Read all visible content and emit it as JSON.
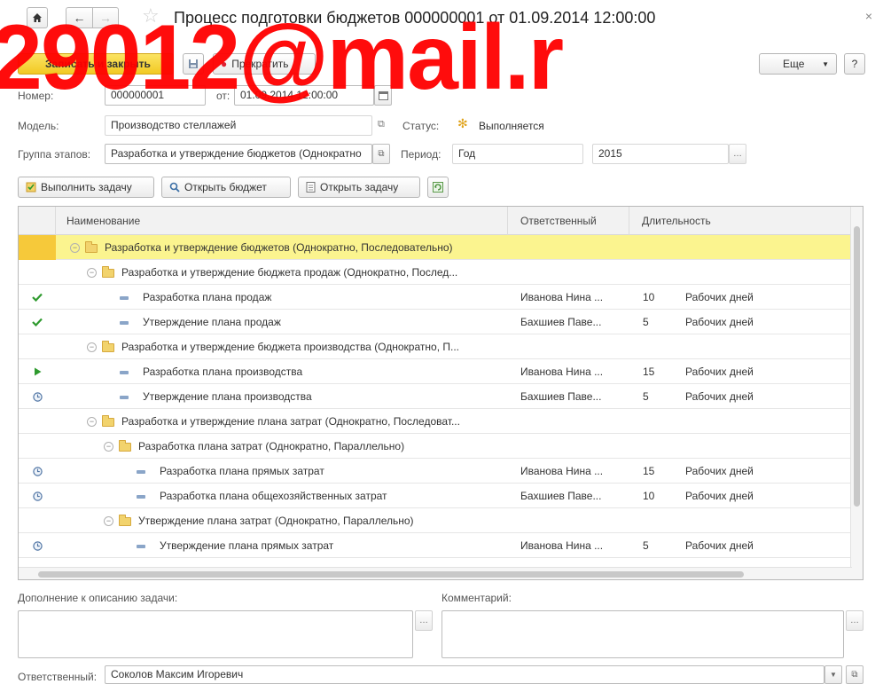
{
  "window": {
    "title": "Процесс подготовки бюджетов 000000001 от 01.09.2014 12:00:00",
    "close_glyph": "×"
  },
  "toolbar": {
    "save_close_label": "Записать и закрыть",
    "stop_label": "Прекратить",
    "more_label": "Еще",
    "help_label": "?"
  },
  "form": {
    "number_label": "Номер:",
    "number_value": "000000001",
    "date_label": "от:",
    "date_value": "01.09.2014 12:00:00",
    "model_label": "Модель:",
    "model_value": "Производство стеллажей",
    "status_label": "Статус:",
    "status_value": "Выполняется",
    "stage_group_label": "Группа этапов:",
    "stage_group_value": "Разработка и утверждение бюджетов (Однократно",
    "period_label": "Период:",
    "period_value": "Год",
    "year_value": "2015"
  },
  "actions": {
    "execute_task": "Выполнить задачу",
    "open_budget": "Открыть бюджет",
    "open_task": "Открыть задачу"
  },
  "table": {
    "headers": {
      "name": "Наименование",
      "responsible": "Ответственный",
      "duration": "Длительность"
    },
    "rows": [
      {
        "type": "group",
        "level": 0,
        "status": "",
        "name": "Разработка и утверждение бюджетов (Однократно, Последовательно)",
        "responsible": "",
        "duration": "",
        "unit": "",
        "selected": true
      },
      {
        "type": "group",
        "level": 1,
        "status": "",
        "name": "Разработка и утверждение бюджета продаж (Однократно, Послед...",
        "responsible": "",
        "duration": "",
        "unit": ""
      },
      {
        "type": "task",
        "level": 2,
        "status": "done",
        "name": "Разработка плана продаж",
        "responsible": "Иванова Нина ...",
        "duration": "10",
        "unit": "Рабочих дней"
      },
      {
        "type": "task",
        "level": 2,
        "status": "done",
        "name": "Утверждение плана продаж",
        "responsible": "Бахшиев Паве...",
        "duration": "5",
        "unit": "Рабочих дней"
      },
      {
        "type": "group",
        "level": 1,
        "status": "",
        "name": "Разработка и утверждение бюджета производства (Однократно, П...",
        "responsible": "",
        "duration": "",
        "unit": ""
      },
      {
        "type": "task",
        "level": 2,
        "status": "running",
        "name": "Разработка плана производства",
        "responsible": "Иванова Нина ...",
        "duration": "15",
        "unit": "Рабочих дней"
      },
      {
        "type": "task",
        "level": 2,
        "status": "waiting",
        "name": "Утверждение плана производства",
        "responsible": "Бахшиев Паве...",
        "duration": "5",
        "unit": "Рабочих дней"
      },
      {
        "type": "group",
        "level": 1,
        "status": "",
        "name": "Разработка и утверждение плана затрат (Однократно, Последоват...",
        "responsible": "",
        "duration": "",
        "unit": ""
      },
      {
        "type": "group",
        "level": 2,
        "status": "",
        "name": "Разработка плана затрат (Однократно, Параллельно)",
        "responsible": "",
        "duration": "",
        "unit": ""
      },
      {
        "type": "task",
        "level": 3,
        "status": "waiting",
        "name": "Разработка плана прямых затрат",
        "responsible": "Иванова Нина ...",
        "duration": "15",
        "unit": "Рабочих дней"
      },
      {
        "type": "task",
        "level": 3,
        "status": "waiting",
        "name": "Разработка плана общехозяйственных затрат",
        "responsible": "Бахшиев Паве...",
        "duration": "10",
        "unit": "Рабочих дней"
      },
      {
        "type": "group",
        "level": 2,
        "status": "",
        "name": "Утверждение плана затрат (Однократно, Параллельно)",
        "responsible": "",
        "duration": "",
        "unit": ""
      },
      {
        "type": "task",
        "level": 3,
        "status": "waiting",
        "name": "Утверждение плана прямых затрат",
        "responsible": "Иванова Нина ...",
        "duration": "5",
        "unit": "Рабочих дней"
      }
    ]
  },
  "bottom": {
    "description_label": "Дополнение к описанию задачи:",
    "comment_label": "Комментарий:",
    "responsible_label": "Ответственный:",
    "responsible_value": "Соколов Максим Игоревич"
  },
  "watermark": {
    "text": "29012@mail.r"
  },
  "colors": {
    "primary_button": "#f2c923",
    "selected_row": "#fbf48f",
    "done_check": "#2e9a2e",
    "running_arrow": "#2e9a2e",
    "watermark": "#ff0000"
  }
}
